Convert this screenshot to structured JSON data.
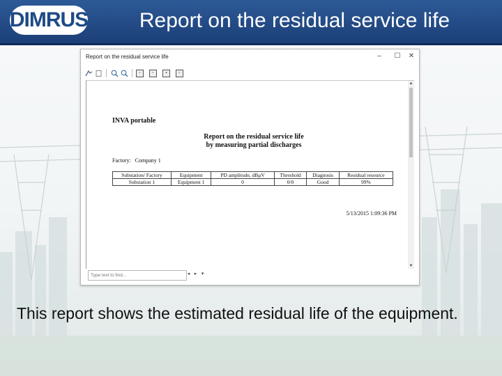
{
  "slide": {
    "logo_text": "DIMRUS",
    "title": "Report on the residual service life",
    "caption": "This report shows the estimated residual life of the equipment."
  },
  "window": {
    "title": "Report on the residual service life",
    "controls": {
      "minimize": "–",
      "maximize": "☐",
      "close": "✕"
    },
    "toolbar_icons": [
      "save-icon",
      "refresh-icon",
      "zoom-in-icon",
      "zoom-out-icon",
      "single-page-icon",
      "multi-page-icon",
      "fit-page-icon",
      "export-icon"
    ]
  },
  "report": {
    "product": "INVA portable",
    "heading_line1": "Report on the residual service life",
    "heading_line2": "by measuring partial discharges",
    "factory_label": "Factory:",
    "factory_value": "Company 1",
    "table": {
      "headers": [
        "Substation/ Factory",
        "Equipment",
        "PD amplitude, dBμV",
        "Threshold",
        "Diagnosis",
        "Residual resource"
      ],
      "rows": [
        [
          "Substation 1",
          "Equipment 1",
          "0",
          "0/0",
          "Good",
          "99%"
        ]
      ]
    },
    "timestamp": "5/13/2015 1:09:36 PM"
  },
  "findbar": {
    "placeholder": "Type text to find..."
  },
  "colors": {
    "banner": "#1f4a86",
    "title_text": "#ffffff",
    "background": "#f4f7f8"
  }
}
